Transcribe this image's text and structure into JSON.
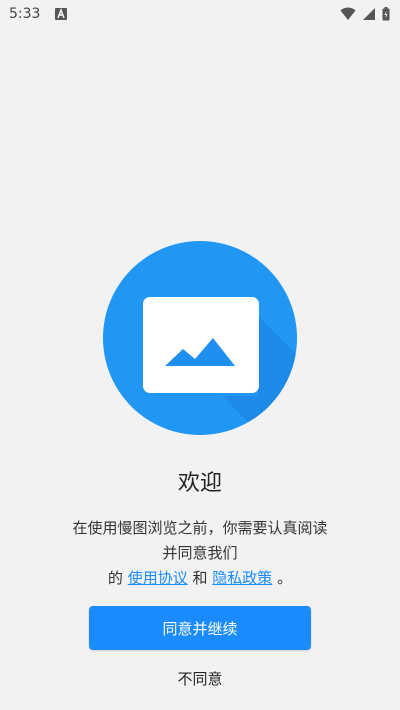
{
  "status_bar": {
    "time": "5:33",
    "notification_icon": "a-letter-icon",
    "icons": [
      "wifi-icon",
      "cell-signal-icon",
      "battery-icon"
    ]
  },
  "logo": {
    "icon": "picture-icon",
    "circle_color": "#2196f3",
    "card_color": "#ffffff"
  },
  "welcome": {
    "title": "欢迎",
    "message_line1": "在使用慢图浏览之前，你需要认真阅读",
    "message_line2": "并同意我们",
    "prefix": "的",
    "terms_link": "使用协议",
    "conjunction": "和",
    "privacy_link": "隐私政策",
    "suffix": "。"
  },
  "actions": {
    "agree_label": "同意并继续",
    "disagree_label": "不同意"
  },
  "colors": {
    "accent": "#1a8cff",
    "background": "#f2f2f2"
  }
}
